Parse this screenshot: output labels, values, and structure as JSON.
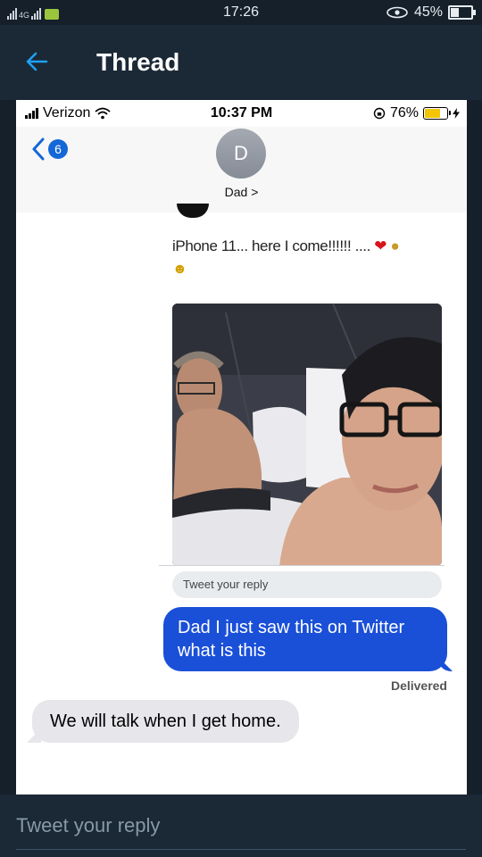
{
  "android_status": {
    "network_labels": [
      "4G"
    ],
    "time": "17:26",
    "battery": "45%",
    "battery_level": 0.45
  },
  "header": {
    "title": "Thread"
  },
  "screenshot": {
    "status": {
      "carrier": "Verizon",
      "time": "10:37 PM",
      "battery": "76%",
      "battery_level": 0.76
    },
    "back_badge": "6",
    "contact": {
      "initial": "D",
      "name": "Dad >"
    },
    "tweet": {
      "text": "iPhone 11... here I come!!!!!! ....",
      "reply_placeholder": "Tweet your reply"
    },
    "messages": [
      {
        "direction": "outgoing",
        "text": "Dad I just saw this on Twitter what is this"
      },
      {
        "direction": "incoming",
        "text": "We will talk when I get home."
      }
    ],
    "delivered_label": "Delivered"
  },
  "composer": {
    "placeholder": "Tweet your reply"
  },
  "colors": {
    "twitter_bg": "#15202b",
    "twitter_accent": "#1da1f2",
    "imessage_blue": "#1a4fd8",
    "incoming_gray": "#e6e6eb"
  }
}
